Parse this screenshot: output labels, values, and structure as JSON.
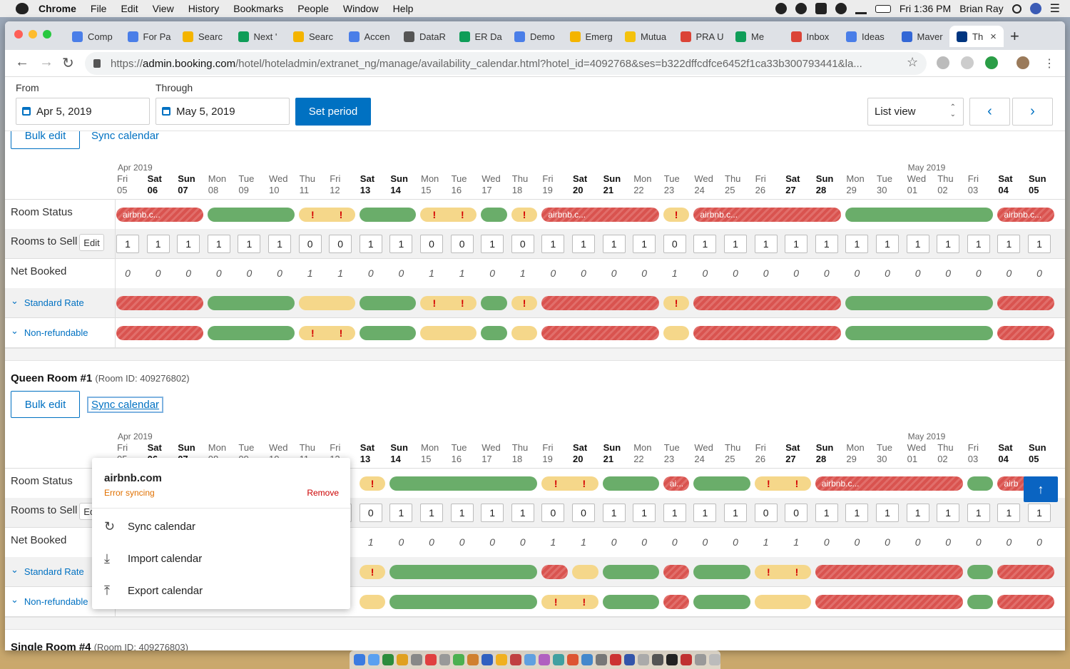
{
  "menubar": {
    "app": "Chrome",
    "items": [
      "File",
      "Edit",
      "View",
      "History",
      "Bookmarks",
      "People",
      "Window",
      "Help"
    ],
    "clock": "Fri 1:36 PM",
    "user": "Brian Ray"
  },
  "tabs": [
    {
      "title": "Comp",
      "color": "#4a7ee8"
    },
    {
      "title": "For Pa",
      "color": "#4a7ee8"
    },
    {
      "title": "Searc",
      "color": "#f4b400"
    },
    {
      "title": "Next '",
      "color": "#0f9d58"
    },
    {
      "title": "Searc",
      "color": "#f4b400"
    },
    {
      "title": "Accen",
      "color": "#4a7ee8"
    },
    {
      "title": "DataR",
      "color": "#555555"
    },
    {
      "title": "ER Da",
      "color": "#0f9d58"
    },
    {
      "title": "Demo",
      "color": "#4a7ee8"
    },
    {
      "title": "Emerg",
      "color": "#f4b400"
    },
    {
      "title": "Mutua",
      "color": "#f4c20d"
    },
    {
      "title": "PRA U",
      "color": "#db4437"
    },
    {
      "title": "Me",
      "color": "#0f9d58"
    },
    {
      "title": "Inbox",
      "color": "#db4437"
    },
    {
      "title": "Ideas",
      "color": "#4a7ee8"
    },
    {
      "title": "Maver",
      "color": "#3367d6"
    },
    {
      "title": "Th",
      "color": "#003580"
    }
  ],
  "url": {
    "scheme": "https://",
    "host": "admin.booking.com",
    "path": "/hotel/hoteladmin/extranet_ng/manage/availability_calendar.html?hotel_id=4092768&ses=b322dffcdfce6452f1ca33b300793441&la..."
  },
  "period": {
    "from_label": "From",
    "through_label": "Through",
    "from": "Apr 5, 2019",
    "through": "May 5, 2019",
    "set_label": "Set period",
    "view": "List view"
  },
  "actions": {
    "bulk_edit": "Bulk edit",
    "sync_calendar": "Sync calendar",
    "edit": "Edit"
  },
  "calendar": {
    "months": [
      {
        "label": "Apr 2019",
        "col": 0
      },
      {
        "label": "May 2019",
        "col": 26
      }
    ],
    "days": [
      {
        "dow": "Fri",
        "d": "05",
        "we": false
      },
      {
        "dow": "Sat",
        "d": "06",
        "we": true
      },
      {
        "dow": "Sun",
        "d": "07",
        "we": true
      },
      {
        "dow": "Mon",
        "d": "08",
        "we": false
      },
      {
        "dow": "Tue",
        "d": "09",
        "we": false
      },
      {
        "dow": "Wed",
        "d": "10",
        "we": false
      },
      {
        "dow": "Thu",
        "d": "11",
        "we": false
      },
      {
        "dow": "Fri",
        "d": "12",
        "we": false
      },
      {
        "dow": "Sat",
        "d": "13",
        "we": true
      },
      {
        "dow": "Sun",
        "d": "14",
        "we": true
      },
      {
        "dow": "Mon",
        "d": "15",
        "we": false
      },
      {
        "dow": "Tue",
        "d": "16",
        "we": false
      },
      {
        "dow": "Wed",
        "d": "17",
        "we": false
      },
      {
        "dow": "Thu",
        "d": "18",
        "we": false
      },
      {
        "dow": "Fri",
        "d": "19",
        "we": false
      },
      {
        "dow": "Sat",
        "d": "20",
        "we": true
      },
      {
        "dow": "Sun",
        "d": "21",
        "we": true
      },
      {
        "dow": "Mon",
        "d": "22",
        "we": false
      },
      {
        "dow": "Tue",
        "d": "23",
        "we": false
      },
      {
        "dow": "Wed",
        "d": "24",
        "we": false
      },
      {
        "dow": "Thu",
        "d": "25",
        "we": false
      },
      {
        "dow": "Fri",
        "d": "26",
        "we": false
      },
      {
        "dow": "Sat",
        "d": "27",
        "we": true
      },
      {
        "dow": "Sun",
        "d": "28",
        "we": true
      },
      {
        "dow": "Mon",
        "d": "29",
        "we": false
      },
      {
        "dow": "Tue",
        "d": "30",
        "we": false
      },
      {
        "dow": "Wed",
        "d": "01",
        "we": false
      },
      {
        "dow": "Thu",
        "d": "02",
        "we": false
      },
      {
        "dow": "Fri",
        "d": "03",
        "we": false
      },
      {
        "dow": "Sat",
        "d": "04",
        "we": true
      },
      {
        "dow": "Sun",
        "d": "05",
        "we": true
      }
    ],
    "row_labels": {
      "status": "Room Status",
      "sell": "Rooms to Sell",
      "booked": "Net Booked",
      "standard": "Standard Rate",
      "nonref": "Non-refundable"
    }
  },
  "rooms": [
    {
      "name": "",
      "room_id": "",
      "status": [
        [
          "r",
          0,
          2,
          "airbnb.c..."
        ],
        [
          "g",
          3,
          5,
          ""
        ],
        [
          "y",
          6,
          7,
          ""
        ],
        [
          "g",
          8,
          9,
          ""
        ],
        [
          "y",
          10,
          11,
          ""
        ],
        [
          "g",
          12,
          12,
          ""
        ],
        [
          "y",
          13,
          13,
          ""
        ],
        [
          "r",
          14,
          17,
          "airbnb.c..."
        ],
        [
          "y",
          18,
          18,
          ""
        ],
        [
          "r",
          19,
          23,
          "airbnb.c..."
        ],
        [
          "g",
          24,
          28,
          ""
        ],
        [
          "r",
          29,
          30,
          "airbnb.c..."
        ]
      ],
      "sell": [
        1,
        1,
        1,
        1,
        1,
        1,
        0,
        0,
        1,
        1,
        0,
        0,
        1,
        0,
        1,
        1,
        1,
        1,
        0,
        1,
        1,
        1,
        1,
        1,
        1,
        1,
        1,
        1,
        1,
        1,
        1
      ],
      "booked": [
        0,
        0,
        0,
        0,
        0,
        0,
        1,
        1,
        0,
        0,
        1,
        1,
        0,
        1,
        0,
        0,
        0,
        0,
        1,
        0,
        0,
        0,
        0,
        0,
        0,
        0,
        0,
        0,
        0,
        0,
        0
      ],
      "standard": [
        [
          "r",
          0,
          2,
          ""
        ],
        [
          "g",
          3,
          5,
          ""
        ],
        [
          "p",
          6,
          7,
          ""
        ],
        [
          "g",
          8,
          9,
          ""
        ],
        [
          "y",
          10,
          11,
          ""
        ],
        [
          "g",
          12,
          12,
          ""
        ],
        [
          "y",
          13,
          13,
          ""
        ],
        [
          "r",
          14,
          17,
          ""
        ],
        [
          "y",
          18,
          18,
          ""
        ],
        [
          "r",
          19,
          23,
          ""
        ],
        [
          "g",
          24,
          28,
          ""
        ],
        [
          "r",
          29,
          30,
          ""
        ]
      ],
      "nonref": [
        [
          "r",
          0,
          2,
          ""
        ],
        [
          "g",
          3,
          5,
          ""
        ],
        [
          "y",
          6,
          7,
          ""
        ],
        [
          "g",
          8,
          9,
          ""
        ],
        [
          "p",
          10,
          11,
          ""
        ],
        [
          "g",
          12,
          12,
          ""
        ],
        [
          "p",
          13,
          13,
          ""
        ],
        [
          "r",
          14,
          17,
          ""
        ],
        [
          "p",
          18,
          18,
          ""
        ],
        [
          "r",
          19,
          23,
          ""
        ],
        [
          "g",
          24,
          28,
          ""
        ],
        [
          "r",
          29,
          30,
          ""
        ]
      ]
    },
    {
      "name": "Queen Room #1",
      "room_id": "(Room ID: 409276802)",
      "status": [
        [
          "y",
          8,
          8,
          ""
        ],
        [
          "g",
          9,
          13,
          ""
        ],
        [
          "y",
          14,
          15,
          ""
        ],
        [
          "g",
          16,
          17,
          ""
        ],
        [
          "r",
          18,
          18,
          "ai..."
        ],
        [
          "g",
          19,
          20,
          ""
        ],
        [
          "y",
          21,
          22,
          ""
        ],
        [
          "r",
          23,
          27,
          "airbnb.c..."
        ],
        [
          "g",
          28,
          28,
          ""
        ],
        [
          "r",
          29,
          30,
          "airb"
        ]
      ],
      "sell": [
        1,
        1,
        1,
        1,
        1,
        1,
        1,
        1,
        0,
        1,
        1,
        1,
        1,
        1,
        0,
        0,
        1,
        1,
        1,
        1,
        1,
        0,
        0,
        1,
        1,
        1,
        1,
        1,
        1,
        1,
        1
      ],
      "booked": [
        0,
        0,
        0,
        0,
        0,
        0,
        0,
        0,
        1,
        0,
        0,
        0,
        0,
        0,
        1,
        1,
        0,
        0,
        0,
        0,
        0,
        1,
        1,
        0,
        0,
        0,
        0,
        0,
        0,
        0,
        0
      ],
      "standard": [
        [
          "y",
          8,
          8,
          ""
        ],
        [
          "g",
          9,
          13,
          ""
        ],
        [
          "rs",
          14,
          14,
          ""
        ],
        [
          "p",
          15,
          15,
          ""
        ],
        [
          "g",
          16,
          17,
          ""
        ],
        [
          "rs",
          18,
          18,
          ""
        ],
        [
          "g",
          19,
          20,
          ""
        ],
        [
          "y",
          21,
          22,
          ""
        ],
        [
          "r",
          23,
          27,
          ""
        ],
        [
          "g",
          28,
          28,
          ""
        ],
        [
          "r",
          29,
          30,
          ""
        ]
      ],
      "nonref": [
        [
          "p",
          8,
          8,
          ""
        ],
        [
          "g",
          9,
          13,
          ""
        ],
        [
          "y",
          14,
          15,
          ""
        ],
        [
          "g",
          16,
          17,
          ""
        ],
        [
          "r",
          18,
          18,
          ""
        ],
        [
          "g",
          19,
          20,
          ""
        ],
        [
          "p",
          21,
          22,
          ""
        ],
        [
          "r",
          23,
          27,
          ""
        ],
        [
          "g",
          28,
          28,
          ""
        ],
        [
          "r",
          29,
          30,
          ""
        ]
      ]
    }
  ],
  "next_room": {
    "name": "Single Room #4",
    "room_id": "(Room ID: 409276803)"
  },
  "popup": {
    "title": "airbnb.com",
    "status": "Error syncing",
    "remove": "Remove",
    "items": [
      {
        "label": "Sync calendar",
        "icon": "↻"
      },
      {
        "label": "Import calendar",
        "icon": "⤓"
      },
      {
        "label": "Export calendar",
        "icon": "⤒"
      }
    ]
  },
  "colors": {
    "accent": "#0071c2",
    "available": "#6aad6a",
    "closed": "#d9534f",
    "warning": "#f5d78a"
  }
}
